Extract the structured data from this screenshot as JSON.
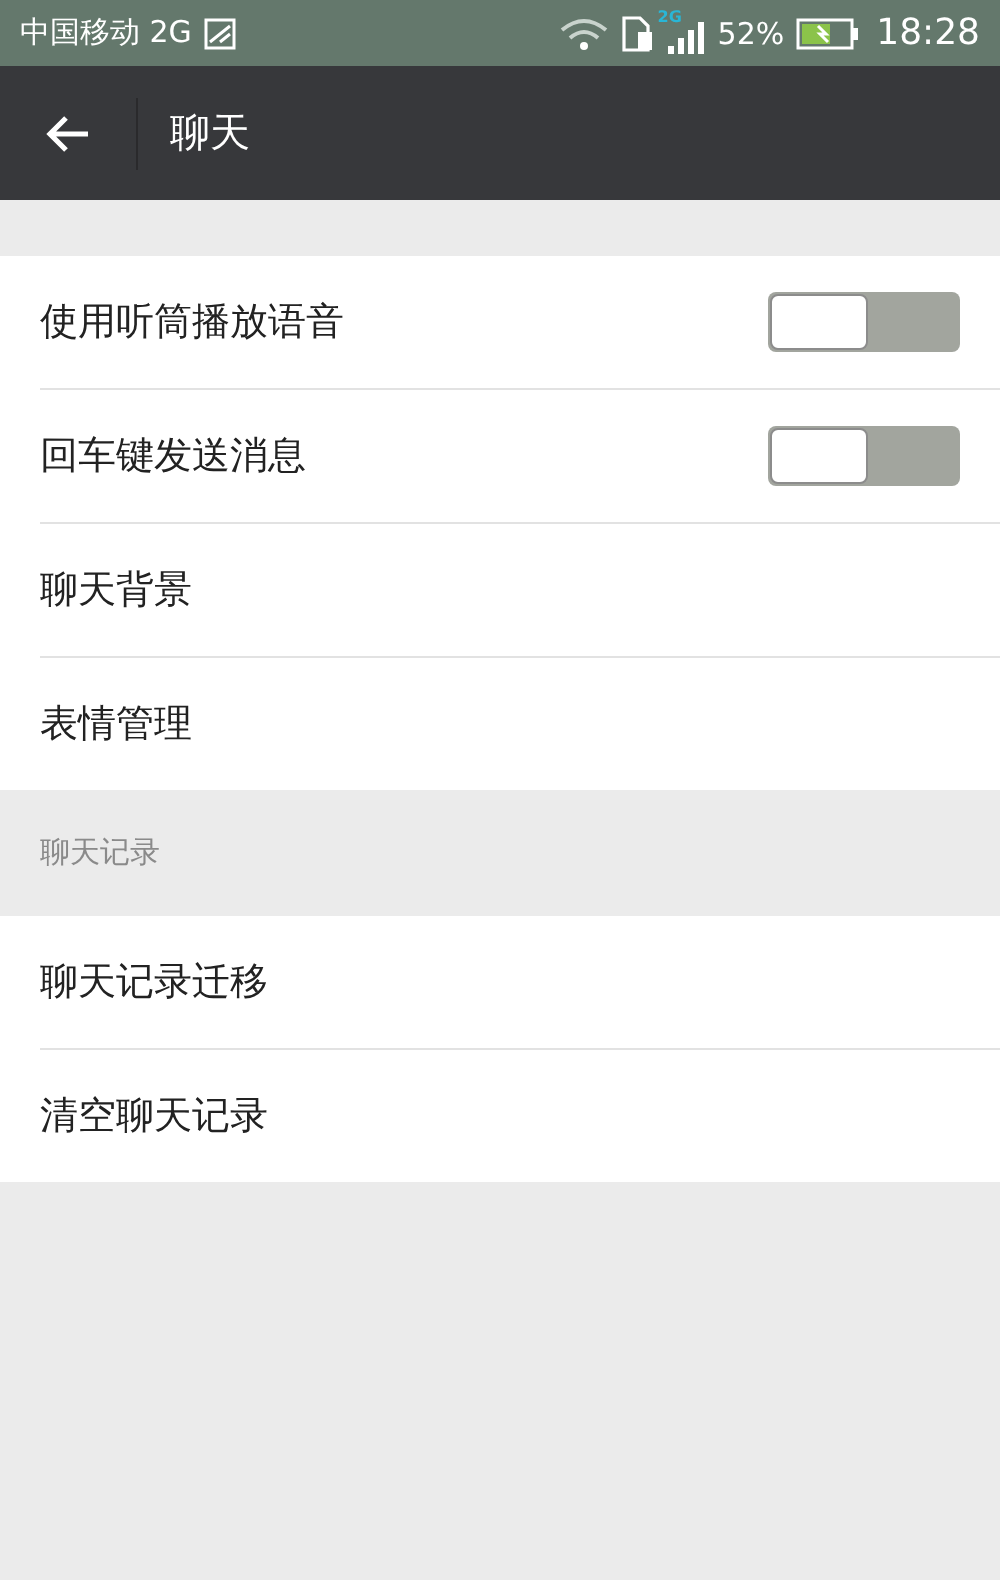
{
  "status_bar": {
    "carrier": "中国移动 2G",
    "signal_badge": "2G",
    "battery": "52%",
    "time": "18:28"
  },
  "header": {
    "title": "聊天"
  },
  "sections": [
    {
      "items": [
        {
          "kind": "switch",
          "label": "使用听筒播放语音",
          "on": false
        },
        {
          "kind": "switch",
          "label": "回车键发送消息",
          "on": false
        },
        {
          "kind": "link",
          "label": "聊天背景"
        },
        {
          "kind": "link",
          "label": "表情管理"
        }
      ]
    },
    {
      "title": "聊天记录",
      "items": [
        {
          "kind": "link",
          "label": "聊天记录迁移"
        },
        {
          "kind": "link",
          "label": "清空聊天记录"
        }
      ]
    }
  ]
}
